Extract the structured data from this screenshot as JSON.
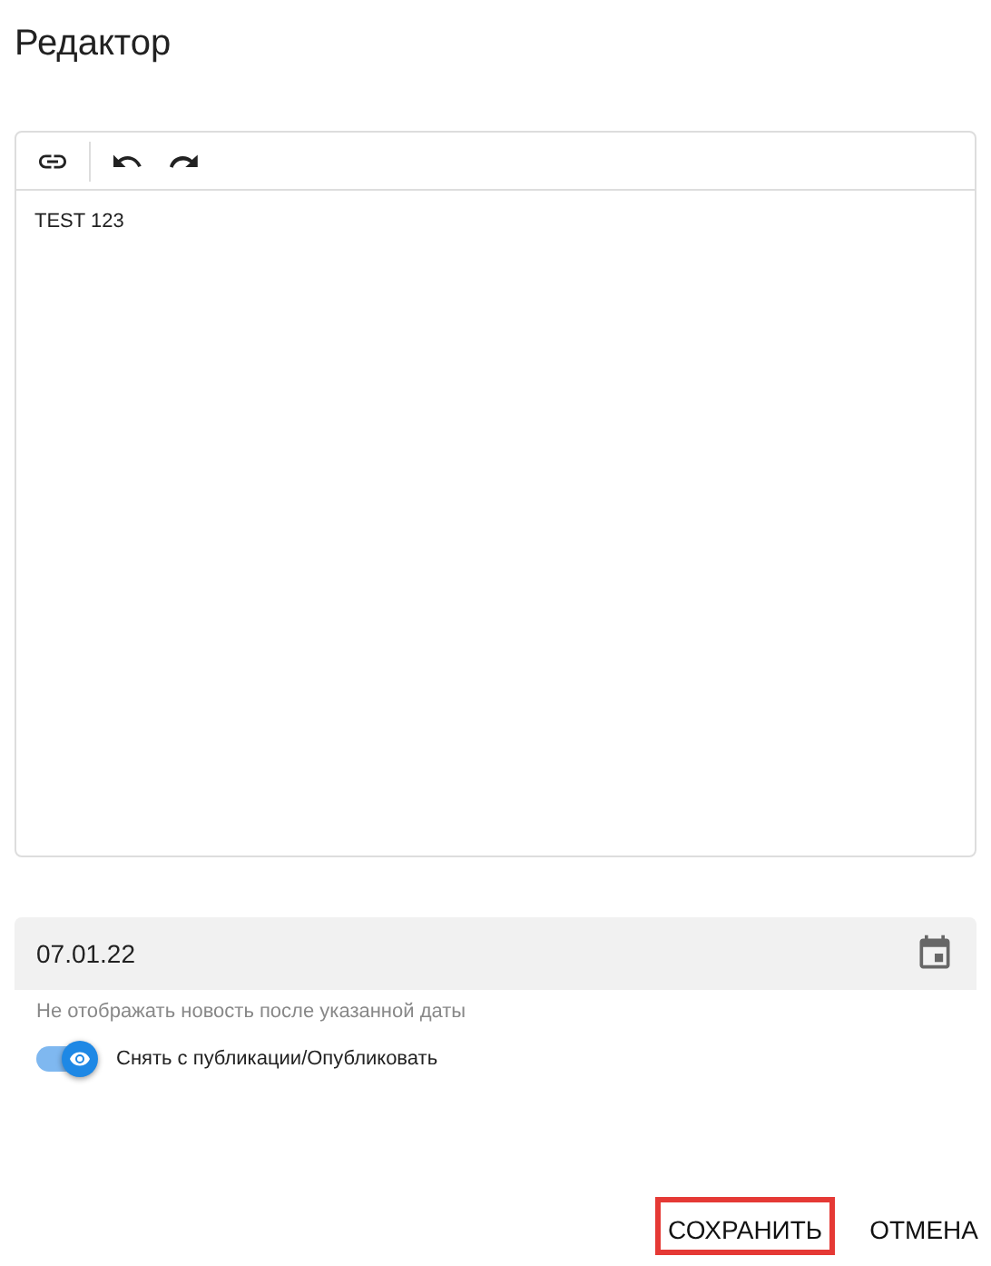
{
  "title": "Редактор",
  "toolbar": [
    {
      "kind": "link"
    },
    {
      "kind": "divider"
    },
    {
      "kind": "undo"
    },
    {
      "kind": "redo"
    }
  ],
  "editor": {
    "value": "TEST 123"
  },
  "date_field": {
    "value": "07.01.22",
    "helper": "Не отображать новость после указанной даты"
  },
  "publish_toggle": {
    "label": "Снять с публикации/Опубликовать",
    "on": true
  },
  "buttons": [
    {
      "label": "СОХРАНИТЬ",
      "highlighted": true
    },
    {
      "label": "ОТМЕНА",
      "highlighted": false
    }
  ]
}
